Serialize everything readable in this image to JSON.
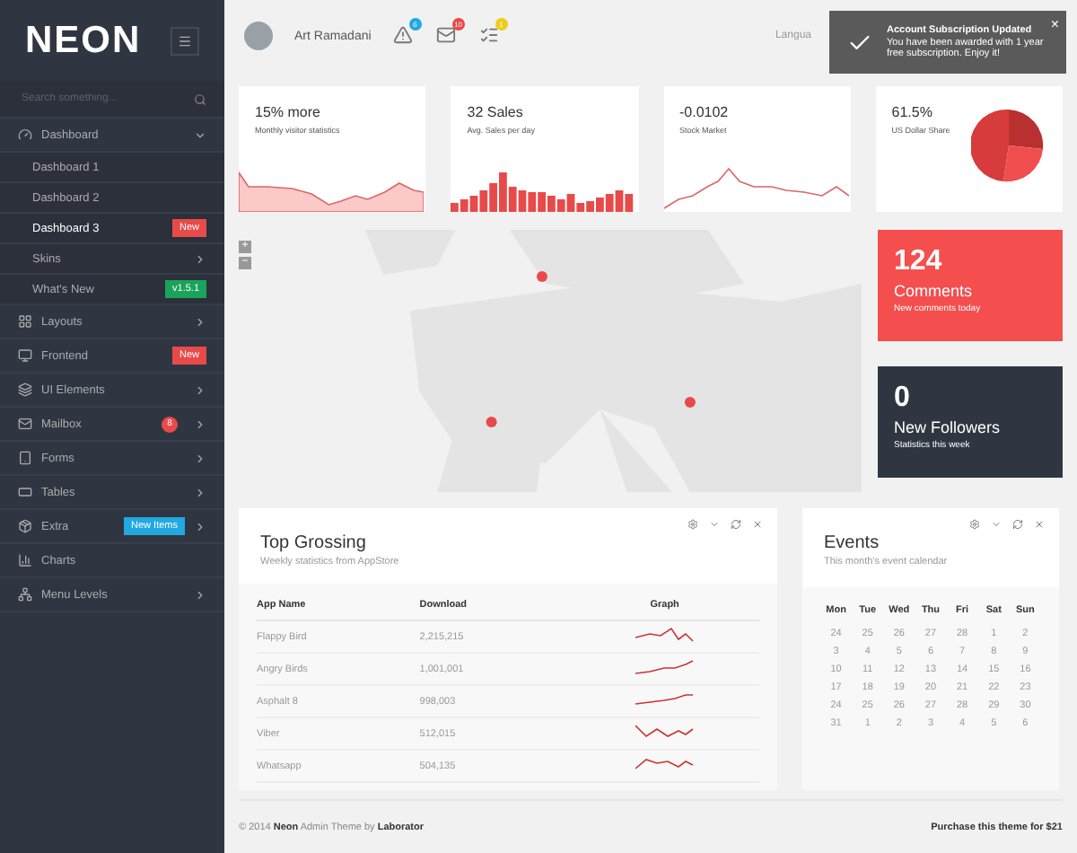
{
  "logo": "NEON",
  "search": {
    "placeholder": "Search something..."
  },
  "sidebar": {
    "items": [
      {
        "label": "Dashboard",
        "expanded": true,
        "children": [
          {
            "label": "Dashboard 1",
            "selected": false
          },
          {
            "label": "Dashboard 2",
            "selected": false
          },
          {
            "label": "Dashboard 3",
            "selected": true,
            "badge": {
              "text": "New",
              "color": "#e84a4a"
            }
          },
          {
            "label": "Skins",
            "selected": false,
            "arrow": true
          },
          {
            "label": "What's New",
            "selected": false,
            "badge": {
              "text": "v1.5.1",
              "color": "#1aa35a"
            }
          }
        ]
      },
      {
        "label": "Layouts",
        "arrow": true
      },
      {
        "label": "Frontend",
        "badge": {
          "text": "New",
          "color": "#e84a4a"
        }
      },
      {
        "label": "UI Elements",
        "arrow": true
      },
      {
        "label": "Mailbox",
        "count": "8",
        "arrow": true
      },
      {
        "label": "Forms",
        "arrow": true
      },
      {
        "label": "Tables",
        "arrow": true
      },
      {
        "label": "Extra",
        "badge": {
          "text": "New Items",
          "color": "#21a9e1"
        },
        "arrow": true
      },
      {
        "label": "Charts"
      },
      {
        "label": "Menu Levels",
        "arrow": true
      }
    ]
  },
  "header": {
    "user": "Art Ramadani",
    "notifications": [
      {
        "count": "6",
        "color": "#21a9e1"
      },
      {
        "count": "10",
        "color": "#e84a4a"
      },
      {
        "count": "1",
        "color": "#f0cc1a"
      }
    ],
    "language_label": "Langua"
  },
  "toast": {
    "title": "Account Subscription Updated",
    "message": "You have been awarded with 1 year free subscription. Enjoy it!",
    "close": "×"
  },
  "stats": [
    {
      "value": "15% more",
      "label": "Monthly visitor statistics",
      "kind": "area"
    },
    {
      "value": "32 Sales",
      "label": "Avg. Sales per day",
      "kind": "bars"
    },
    {
      "value": "-0.0102",
      "label": "Stock Market",
      "kind": "line"
    },
    {
      "value": "61.5%",
      "label": "US Dollar Share",
      "kind": "pie"
    }
  ],
  "map": {
    "zoom_in": "+",
    "zoom_out": "−"
  },
  "tiles": [
    {
      "value": "124",
      "title": "Comments",
      "subtitle": "New comments today",
      "color": "#f44e4e"
    },
    {
      "value": "0",
      "title": "New Followers",
      "subtitle": "Statistics this week",
      "color": "#303641"
    }
  ],
  "top_grossing": {
    "title": "Top Grossing",
    "subtitle": "Weekly statistics from AppStore",
    "columns": [
      "App Name",
      "Download",
      "Graph"
    ],
    "rows": [
      {
        "name": "Flappy Bird",
        "downloads": "2,215,215"
      },
      {
        "name": "Angry Birds",
        "downloads": "1,001,001"
      },
      {
        "name": "Asphalt 8",
        "downloads": "998,003"
      },
      {
        "name": "Viber",
        "downloads": "512,015"
      },
      {
        "name": "Whatsapp",
        "downloads": "504,135"
      }
    ]
  },
  "events": {
    "title": "Events",
    "subtitle": "This month's event calendar",
    "days": [
      "Mon",
      "Tue",
      "Wed",
      "Thu",
      "Fri",
      "Sat",
      "Sun"
    ],
    "weeks": [
      [
        "24",
        "25",
        "26",
        "27",
        "28",
        "1",
        "2"
      ],
      [
        "3",
        "4",
        "5",
        "6",
        "7",
        "8",
        "9"
      ],
      [
        "10",
        "11",
        "12",
        "13",
        "14",
        "15",
        "16"
      ],
      [
        "17",
        "18",
        "19",
        "20",
        "21",
        "22",
        "23"
      ],
      [
        "24",
        "25",
        "26",
        "27",
        "28",
        "29",
        "30"
      ],
      [
        "31",
        "1",
        "2",
        "3",
        "4",
        "5",
        "6"
      ]
    ]
  },
  "footer": {
    "copyright": "© 2014 **Neon** Admin Theme by **Laborator**",
    "purchase": "Purchase this theme for $21"
  }
}
